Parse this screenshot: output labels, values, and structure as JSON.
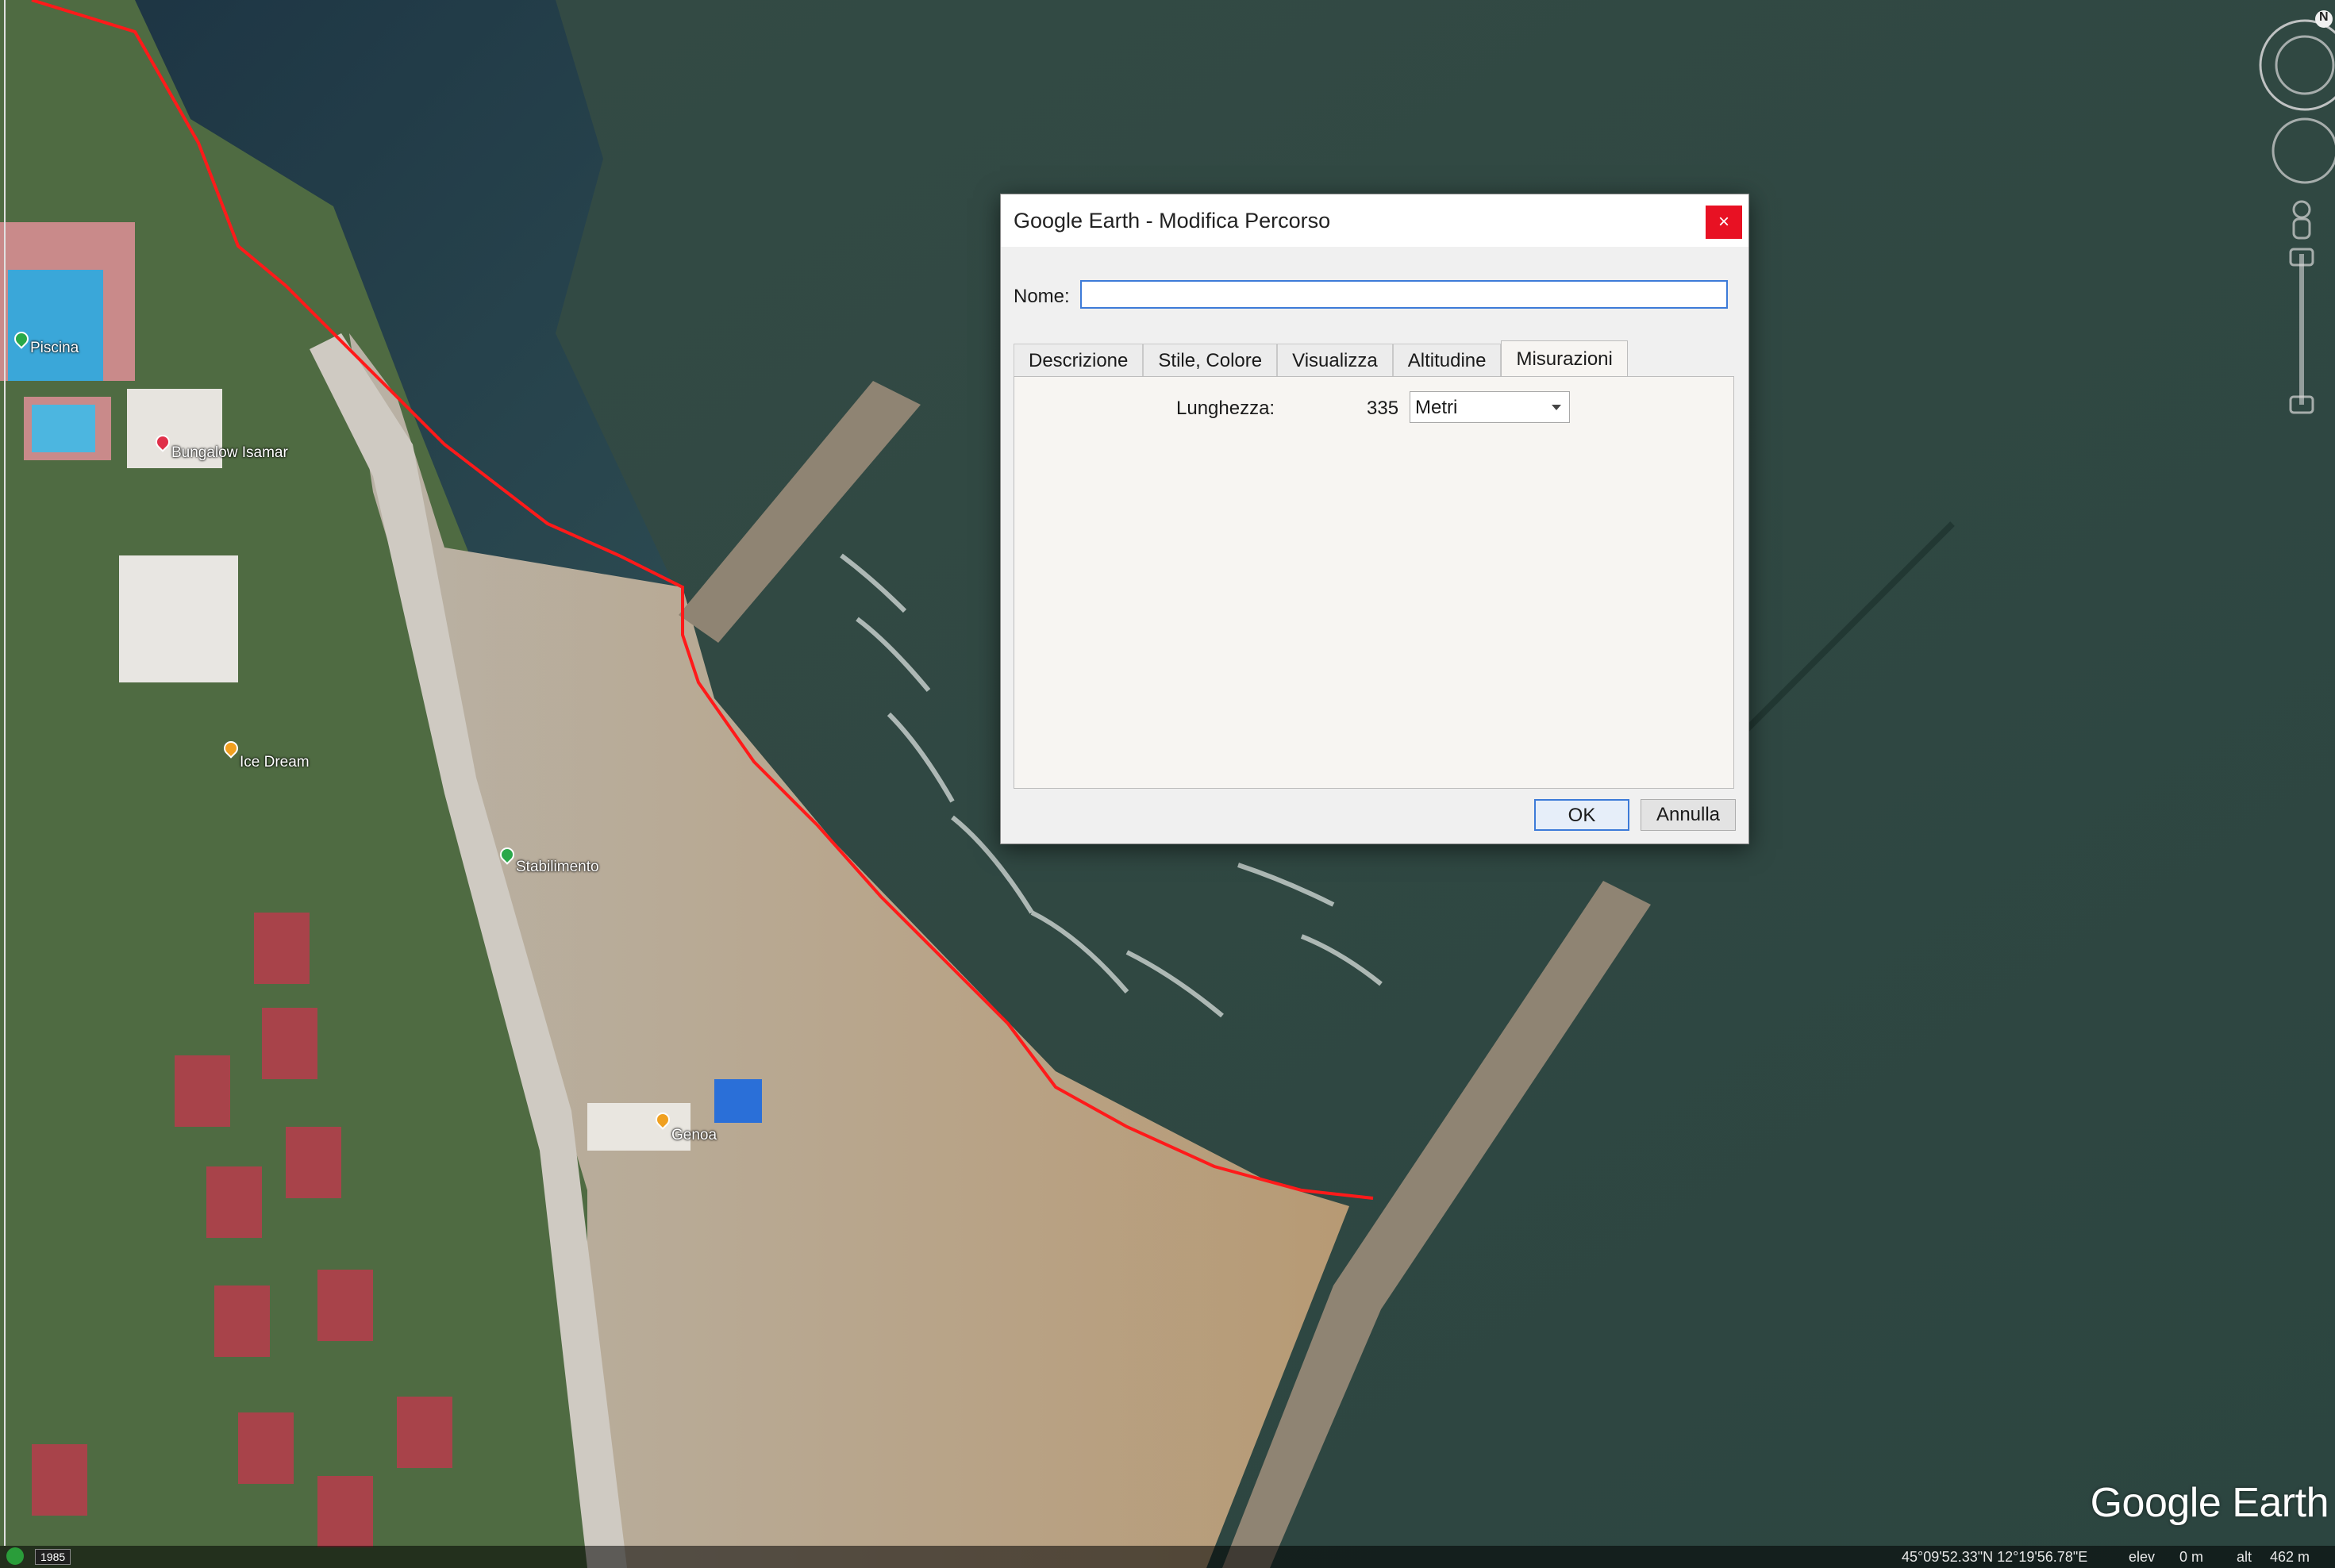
{
  "map": {
    "pois": [
      {
        "label": "Piscina",
        "color": "#2aa84a"
      },
      {
        "label": "Bungalow Isamar",
        "color": "#e0304a"
      },
      {
        "label": "Ice Dream",
        "color": "#f0a020"
      },
      {
        "label": "Stabilimento",
        "color": "#2aa84a"
      },
      {
        "label": "Genoa",
        "color": "#f0a020"
      }
    ],
    "path_color": "#ff1a1a",
    "logo": "Google Earth"
  },
  "navigation": {
    "north_label": "N"
  },
  "statusbar": {
    "historical_year": "1985",
    "coordinates": "45°09'52.33\"N   12°19'56.78\"E",
    "elev_label": "elev",
    "elev_value": "0 m",
    "alt_label": "alt",
    "alt_value": "462 m"
  },
  "dialog": {
    "title": "Google Earth - Modifica Percorso",
    "close_glyph": "×",
    "name_label": "Nome:",
    "name_value": "",
    "tabs": [
      "Descrizione",
      "Stile, Colore",
      "Visualizza",
      "Altitudine",
      "Misurazioni"
    ],
    "active_tab_index": 4,
    "measurements": {
      "length_label": "Lunghezza:",
      "length_value": "335",
      "unit_selected": "Metri"
    },
    "ok_label": "OK",
    "cancel_label": "Annulla"
  }
}
